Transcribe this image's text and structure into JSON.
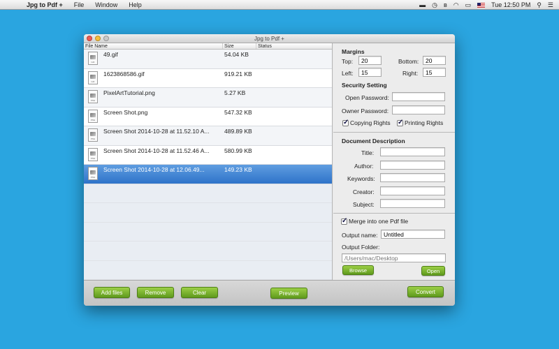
{
  "menubar": {
    "app_name": "Jpg to Pdf +",
    "menus": [
      "File",
      "Window",
      "Help"
    ],
    "clock": "Tue 12:50 PM"
  },
  "window": {
    "title": "Jpg to Pdf +"
  },
  "file_list": {
    "headers": {
      "name": "File Name",
      "size": "Size",
      "status": "Status"
    },
    "files": [
      {
        "name": "49.gif",
        "size": "54.04 KB",
        "type": "GIF"
      },
      {
        "name": "1623868586.gif",
        "size": "919.21 KB",
        "type": "GIF"
      },
      {
        "name": "PixelArtTutorial.png",
        "size": "5.27 KB",
        "type": "PNG"
      },
      {
        "name": "Screen Shot.png",
        "size": "547.32 KB",
        "type": "PNG"
      },
      {
        "name": "Screen Shot 2014-10-28 at 11.52.10 A...",
        "size": "489.89 KB",
        "type": "PNG"
      },
      {
        "name": "Screen Shot 2014-10-28 at 11.52.46 A...",
        "size": "580.99 KB",
        "type": "PNG"
      },
      {
        "name": "Screen Shot 2014-10-28 at 12.06.49...",
        "size": "149.23 KB",
        "type": "PNG",
        "selected": true
      }
    ]
  },
  "margins": {
    "title": "Margins",
    "top_label": "Top:",
    "top": "20",
    "bottom_label": "Bottom:",
    "bottom": "20",
    "left_label": "Left:",
    "left": "15",
    "right_label": "Right:",
    "right": "15"
  },
  "security": {
    "title": "Security Setting",
    "open_password_label": "Open Password:",
    "owner_password_label": "Owner Password:",
    "copying_rights_label": "Copying Rights",
    "printing_rights_label": "Printing Rights"
  },
  "description": {
    "title": "Document Description",
    "title_label": "Title:",
    "author_label": "Author:",
    "keywords_label": "Keywords:",
    "creator_label": "Creator:",
    "subject_label": "Subject:"
  },
  "output": {
    "merge_label": "Merge into one Pdf file",
    "name_label": "Output name:",
    "name_value": "Untitled",
    "folder_label": "Output Folder:",
    "folder_placeholder": "/Users/mac/Desktop",
    "browse_label": "Browse",
    "open_label": "Open"
  },
  "buttons": {
    "add_files": "Add files",
    "remove": "Remove",
    "clear": "Clear",
    "preview": "Preview",
    "convert": "Convert"
  }
}
